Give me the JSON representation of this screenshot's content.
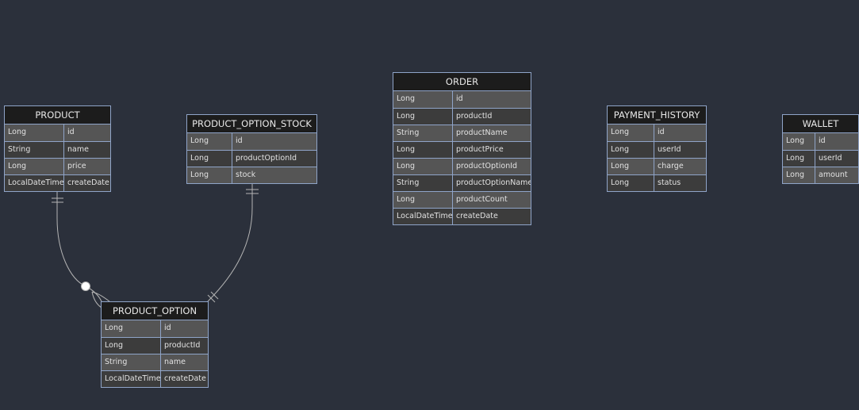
{
  "diagram": {
    "entities": [
      {
        "key": "product",
        "title": "PRODUCT",
        "fields": [
          {
            "type": "Long",
            "name": "id"
          },
          {
            "type": "String",
            "name": "name"
          },
          {
            "type": "Long",
            "name": "price"
          },
          {
            "type": "LocalDateTime",
            "name": "createDate"
          }
        ]
      },
      {
        "key": "product-option-stock",
        "title": "PRODUCT_OPTION_STOCK",
        "fields": [
          {
            "type": "Long",
            "name": "id"
          },
          {
            "type": "Long",
            "name": "productOptionId"
          },
          {
            "type": "Long",
            "name": "stock"
          }
        ]
      },
      {
        "key": "order",
        "title": "ORDER",
        "fields": [
          {
            "type": "Long",
            "name": "id"
          },
          {
            "type": "Long",
            "name": "productId"
          },
          {
            "type": "String",
            "name": "productName"
          },
          {
            "type": "Long",
            "name": "productPrice"
          },
          {
            "type": "Long",
            "name": "productOptionId"
          },
          {
            "type": "String",
            "name": "productOptionName"
          },
          {
            "type": "Long",
            "name": "productCount"
          },
          {
            "type": "LocalDateTime",
            "name": "createDate"
          }
        ]
      },
      {
        "key": "payment-history",
        "title": "PAYMENT_HISTORY",
        "fields": [
          {
            "type": "Long",
            "name": "id"
          },
          {
            "type": "Long",
            "name": "userId"
          },
          {
            "type": "Long",
            "name": "charge"
          },
          {
            "type": "Long",
            "name": "status"
          }
        ]
      },
      {
        "key": "wallet",
        "title": "WALLET",
        "fields": [
          {
            "type": "Long",
            "name": "id"
          },
          {
            "type": "Long",
            "name": "userId"
          },
          {
            "type": "Long",
            "name": "amount"
          }
        ]
      },
      {
        "key": "product-option",
        "title": "PRODUCT_OPTION",
        "fields": [
          {
            "type": "Long",
            "name": "id"
          },
          {
            "type": "Long",
            "name": "productId"
          },
          {
            "type": "String",
            "name": "name"
          },
          {
            "type": "LocalDateTime",
            "name": "createDate"
          }
        ]
      }
    ],
    "relationships": [
      {
        "from": "PRODUCT",
        "to": "PRODUCT_OPTION",
        "from_cardinality": "exactly-one",
        "to_cardinality": "zero-or-many"
      },
      {
        "from": "PRODUCT_OPTION_STOCK",
        "to": "PRODUCT_OPTION",
        "from_cardinality": "exactly-one",
        "to_cardinality": "exactly-one"
      }
    ],
    "colors": {
      "background": "#2b303b",
      "header": "#1c1c1c",
      "row_light": "#555555",
      "row_dark": "#3c3c3c",
      "border": "#8fa4c8",
      "edge": "#b4b4b4",
      "text": "#e2e2e2"
    }
  }
}
